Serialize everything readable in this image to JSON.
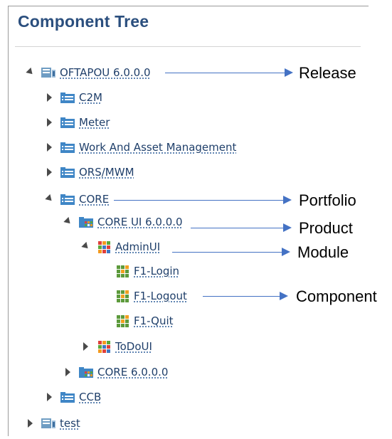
{
  "panel": {
    "title": "Component Tree"
  },
  "tree": {
    "release": "OFTAPOU 6.0.0.0",
    "c2m": "C2M",
    "meter": "Meter",
    "work_asset": "Work And Asset Management",
    "ors_mwm": "ORS/MWM",
    "core": "CORE",
    "core_ui": "CORE UI 6.0.0.0",
    "admin_ui": "AdminUI",
    "f1_login": "F1-Login",
    "f1_logout": "F1-Logout",
    "f1_quit": "F1-Quit",
    "todo_ui": "ToDoUI",
    "core_600": "CORE 6.0.0.0",
    "ccb": "CCB",
    "test": "test"
  },
  "callouts": {
    "release": "Release",
    "portfolio": "Portfolio",
    "product": "Product",
    "module": "Module",
    "component": "Component"
  },
  "colors": {
    "title": "#2b4f7e",
    "label": "#1f3f6a",
    "arrow": "#4472c4",
    "folder_blue": "#3f86c6",
    "release_icon": "#6f9dc3",
    "module_red": "#e0403a",
    "module_orange": "#f39a1e",
    "module_green": "#5aa83a",
    "module_blue": "#3d78c5",
    "component_green": "#5c9a3b",
    "component_orange": "#f0a020"
  }
}
